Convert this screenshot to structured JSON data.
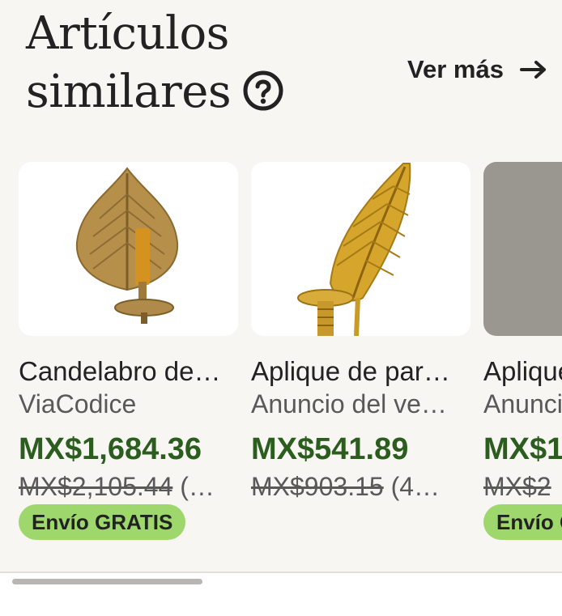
{
  "header": {
    "title_line1": "Artículos",
    "title_line2": "similares",
    "help_icon": "question-circle-icon",
    "see_more_label": "Ver más",
    "see_more_icon": "arrow-right-icon"
  },
  "cards": [
    {
      "title": "Candelabro de…",
      "seller": "ViaCodice",
      "price": "MX$1,684.36",
      "original_price": "MX$2,105.44",
      "discount": "(…",
      "badge": "Envío GRATIS"
    },
    {
      "title": "Aplique de par…",
      "seller": "Anuncio del ve…",
      "price": "MX$541.89",
      "original_price": "MX$903.15",
      "discount": "(4…"
    },
    {
      "title": "Aplique de pared",
      "seller": "Anuncio del vendedor",
      "price": "MX$1",
      "original_price": "MX$2",
      "badge": "Envío GRATIS"
    }
  ],
  "colors": {
    "price_green": "#2b5d1e",
    "badge_green": "#9ed86c",
    "background": "#f8f6f3"
  }
}
